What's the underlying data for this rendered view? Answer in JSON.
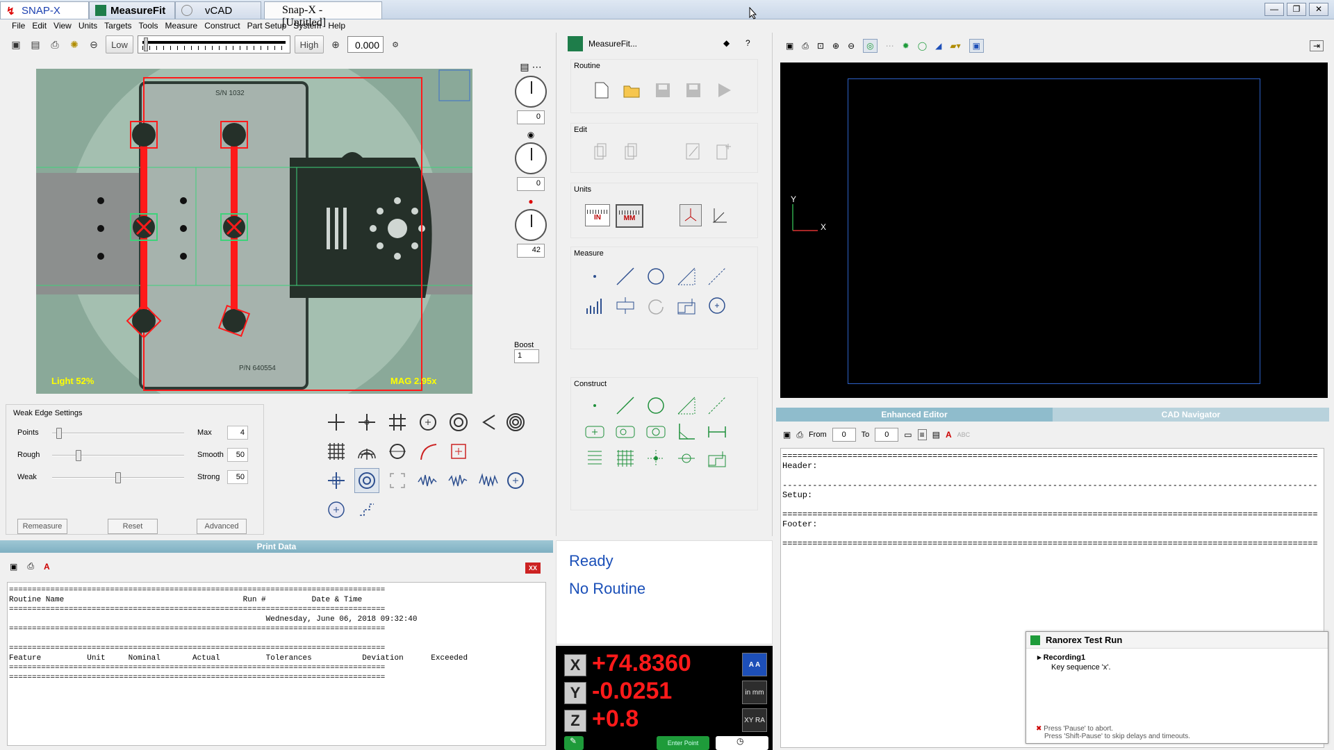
{
  "app_tabs": [
    {
      "label": "SNAP-X"
    },
    {
      "label": "MeasureFit"
    },
    {
      "label": "vCAD"
    }
  ],
  "window_title": "Snap-X - [Untitled]",
  "window_controls": {
    "minimize": "—",
    "maximize": "❐",
    "close": "✕"
  },
  "menu": [
    "File",
    "Edit",
    "View",
    "Units",
    "Targets",
    "Tools",
    "Measure",
    "Construct",
    "Part Setup",
    "System",
    "Help"
  ],
  "toolbar": {
    "low_label": "Low",
    "high_label": "High",
    "zoom_value": "0.000"
  },
  "video": {
    "light_label": "Light 52%",
    "mag_label": "MAG 2.95x",
    "sn_text": "S/N 1032",
    "pn_text": "P/N 640554"
  },
  "dials": {
    "val1": "0",
    "val2": "0",
    "val3": "42",
    "boost_label": "Boost",
    "boost_value": "1"
  },
  "weak_edge": {
    "title": "Weak Edge Settings",
    "rows": [
      {
        "left": "Points",
        "right": "Max",
        "value": "4",
        "level": 0.05
      },
      {
        "left": "Rough",
        "right": "Smooth",
        "value": "50",
        "level": 0.2
      },
      {
        "left": "Weak",
        "right": "Strong",
        "value": "50",
        "level": 0.5
      }
    ],
    "buttons": {
      "remeasure": "Remeasure",
      "reset": "Reset",
      "advanced": "Advanced"
    }
  },
  "print_data": {
    "header": "Print Data",
    "xx_badge": "XX",
    "text": "==================================================================================\nRoutine Name                                       Run #          Date & Time\n==================================================================================\n                                                        Wednesday, June 06, 2018 09:32:40\n==================================================================================\n\n==================================================================================\nFeature          Unit     Nominal       Actual          Tolerances           Deviation      Exceeded\n==================================================================================\n=================================================================================="
  },
  "measurefit": {
    "title": "MeasureFit...",
    "groups": {
      "routine": "Routine",
      "edit": "Edit",
      "units": "Units",
      "measure": "Measure",
      "construct": "Construct"
    },
    "in_label": "IN",
    "mm_label": "MM"
  },
  "status": {
    "line1": "Ready",
    "line2": "No Routine"
  },
  "dro": {
    "x_label": "X",
    "x_value": "+74.8360",
    "y_label": "Y",
    "y_value": "-0.0251",
    "z_label": "Z",
    "z_value": "+0.8",
    "btn_a": "A A",
    "btn_mm": "in mm",
    "btn_xy": "XY RA",
    "bottom_btn": "Enter Point"
  },
  "cad": {
    "axis_y": "Y",
    "axis_x": "X"
  },
  "editor": {
    "tabs": [
      "Enhanced Editor",
      "CAD Navigator"
    ],
    "from_label": "From",
    "from_value": "0",
    "to_label": "To",
    "to_value": "0",
    "abc_label": "ABC",
    "text": "===========================================================================================================\nHeader:\n\n-----------------------------------------------------------------------------------------------------------\nSetup:\n\n===========================================================================================================\nFooter:\n\n==========================================================================================================="
  },
  "ranorex": {
    "title": "Ranorex Test Run",
    "recording": "Recording1",
    "step": "Key sequence 'x'.",
    "hint1": "Press 'Pause' to abort.",
    "hint2": "Press 'Shift-Pause' to skip delays and timeouts."
  },
  "colors": {
    "accent": "#ff0000",
    "dro_red": "#ff1a1a",
    "status_blue": "#1a4fb8",
    "tab_header": "#8fbccc"
  }
}
